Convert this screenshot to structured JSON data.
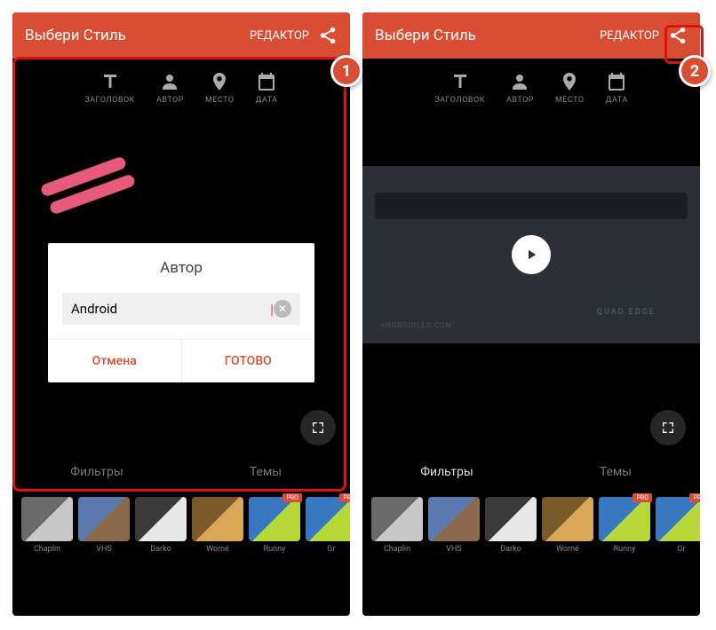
{
  "header": {
    "title": "Выбери Стиль",
    "editor": "РЕДАКТОР"
  },
  "tools": {
    "title": "ЗАГОЛОВОК",
    "author": "АВТОР",
    "place": "МЕСТО",
    "date": "ДАТА"
  },
  "dialog": {
    "title": "Автор",
    "value": "Android",
    "cancel": "Отмена",
    "done": "ГОТОВО"
  },
  "tabs": {
    "filters": "Фильтры",
    "themes": "Темы"
  },
  "preview": {
    "watermark": "QUAD EDGE",
    "url": "ANDROIDLED.COM"
  },
  "filters": [
    {
      "name": "Chaplin",
      "c1": "#6a6a6a",
      "c2": "#c8c8c8",
      "pro": false
    },
    {
      "name": "VHS",
      "c1": "#5a7ab0",
      "c2": "#8a6a4a",
      "pro": false
    },
    {
      "name": "Darko",
      "c1": "#3a3a3a",
      "c2": "#e8e8e8",
      "pro": false
    },
    {
      "name": "Worné",
      "c1": "#7a5a2a",
      "c2": "#d8a858",
      "pro": false
    },
    {
      "name": "Runny",
      "c1": "#3878c0",
      "c2": "#b8d838",
      "pro": true
    },
    {
      "name": "Gr",
      "c1": "#3878c0",
      "c2": "#b8d838",
      "pro": true
    }
  ],
  "markers": {
    "m1": "1",
    "m2": "2"
  }
}
